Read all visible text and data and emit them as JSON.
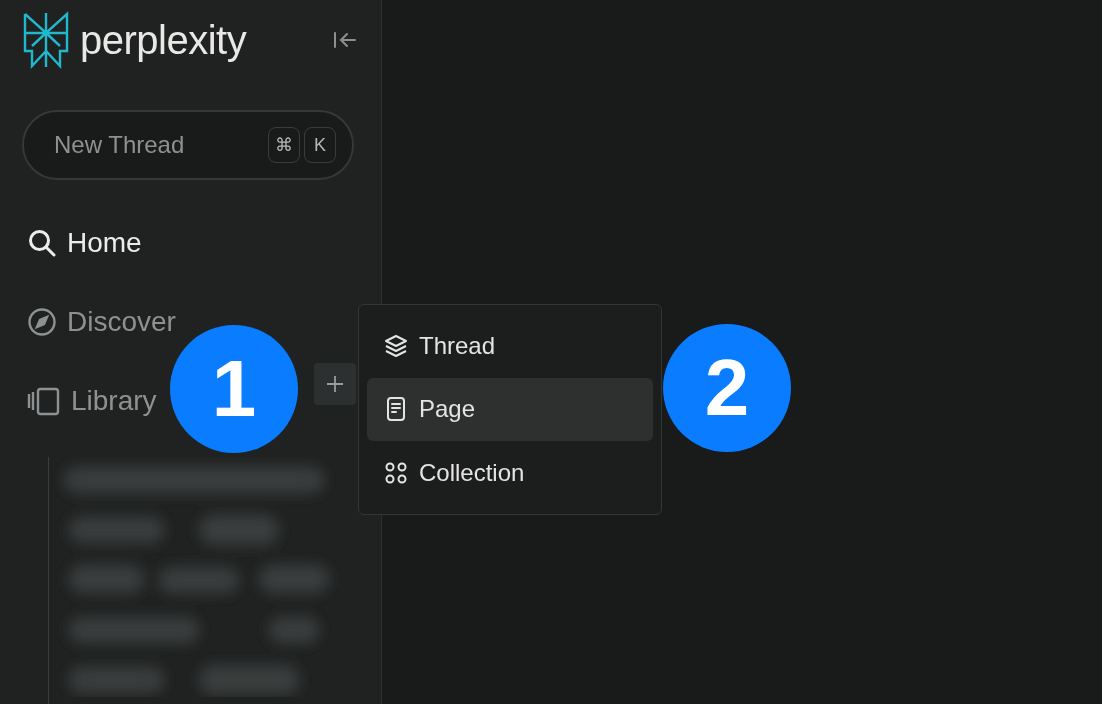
{
  "brand": {
    "name": "perplexity"
  },
  "new_thread": {
    "label": "New Thread",
    "keys": [
      "⌘",
      "K"
    ]
  },
  "nav": [
    {
      "label": "Home",
      "selected": true
    },
    {
      "label": "Discover",
      "selected": false
    },
    {
      "label": "Library",
      "selected": false
    }
  ],
  "add_menu": {
    "items": [
      {
        "label": "Thread",
        "selected": false
      },
      {
        "label": "Page",
        "selected": true
      },
      {
        "label": "Collection",
        "selected": false
      }
    ]
  },
  "callouts": [
    "1",
    "2"
  ]
}
